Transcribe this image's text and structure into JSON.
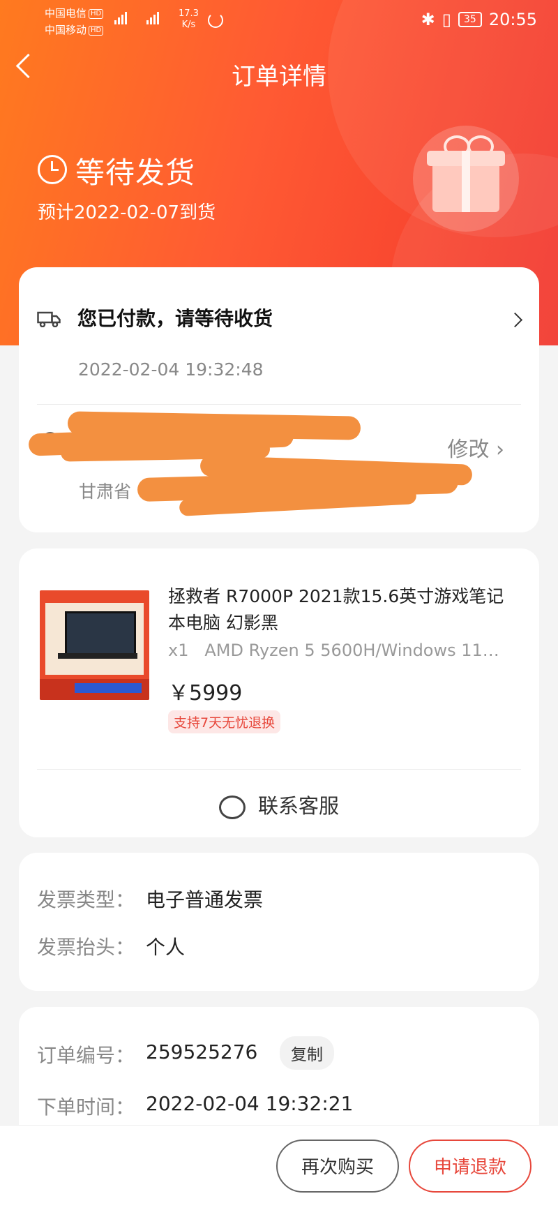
{
  "status_bar": {
    "carrier1": "中国电信",
    "carrier2": "中国移动",
    "hd": "HD",
    "net_label": "4G",
    "speed_value": "17.3",
    "speed_unit": "K/s",
    "battery": "35",
    "time": "20:55"
  },
  "nav": {
    "title": "订单详情"
  },
  "order_status": {
    "title": "等待发货",
    "eta": "预计2022-02-07到货"
  },
  "logistics": {
    "title": "您已付款，请等待收货",
    "time": "2022-02-04 19:32:48",
    "edit_label": "修改",
    "address_visible": "甘肃省"
  },
  "product": {
    "title": "拯救者 R7000P 2021款15.6英寸游戏笔记本电脑 幻影黑",
    "quantity": "x1",
    "spec": "AMD Ryzen 5  5600H/Windows 11…",
    "price": "￥5999",
    "tag": "支持7天无忧退换",
    "customer_service": "联系客服"
  },
  "invoice": {
    "type_label": "发票类型：",
    "type_value": "电子普通发票",
    "header_label": "发票抬头：",
    "header_value": "个人"
  },
  "order_info": {
    "number_label": "订单编号：",
    "number_value": "259525276",
    "copy_label": "复制",
    "time_label": "下单时间：",
    "time_value": "2022-02-04 19:32:21"
  },
  "actions": {
    "rebuy": "再次购买",
    "refund": "申请退款"
  },
  "colors": {
    "accent": "#e7473b",
    "hero_start": "#ff7a1f",
    "hero_end": "#f2362d"
  }
}
